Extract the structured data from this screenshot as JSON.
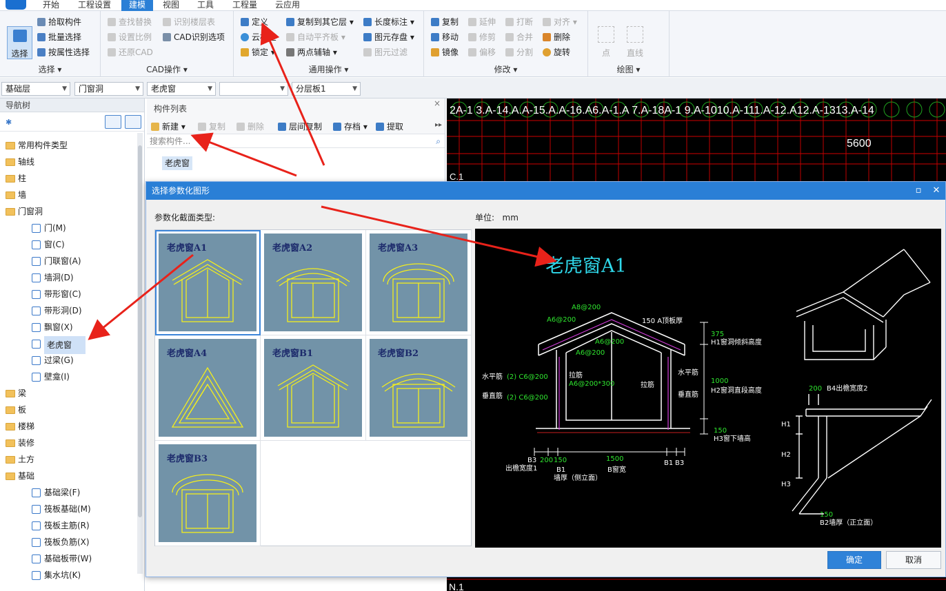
{
  "menu": {
    "items": [
      "开始",
      "工程设置",
      "建模",
      "视图",
      "工具",
      "工程量",
      "云应用"
    ],
    "active_index": 2
  },
  "ribbon": {
    "select_group": {
      "title": "选择",
      "select_label": "选择",
      "pick": "拾取构件",
      "batch": "批量选择",
      "by_attr": "按属性选择"
    },
    "cad_group": {
      "title": "CAD操作",
      "find_replace": "查找替换",
      "recognize_floor": "识别楼层表",
      "set_scale": "设置比例",
      "cad_options": "CAD识别选项",
      "restore_cad": "还原CAD"
    },
    "common_group": {
      "title": "通用操作",
      "define": "定义",
      "cloud_check": "云检查",
      "lock": "锁定",
      "copy_other_floor": "复制到其它层",
      "auto_align": "自动平齐板",
      "two_point_axis": "两点辅轴",
      "length_dim": "长度标注",
      "elem_save": "图元存盘",
      "elem_filter": "图元过滤"
    },
    "modify_group": {
      "title": "修改",
      "copy": "复制",
      "extend": "延伸",
      "break": "打断",
      "align": "对齐",
      "move": "移动",
      "trim": "修剪",
      "merge": "合并",
      "delete": "删除",
      "mirror": "镜像",
      "offset": "偏移",
      "split": "分割",
      "rotate": "旋转"
    },
    "draw_group": {
      "title": "绘图",
      "point": "点",
      "line": "直线"
    }
  },
  "combos": [
    "基础层",
    "门窗洞",
    "老虎窗",
    "",
    "分层板1"
  ],
  "nav": {
    "title": "导航树",
    "items": [
      {
        "label": "常用构件类型",
        "type": "folder"
      },
      {
        "label": "轴线",
        "type": "folder"
      },
      {
        "label": "柱",
        "type": "folder"
      },
      {
        "label": "墙",
        "type": "folder"
      },
      {
        "label": "门窗洞",
        "type": "folder-open"
      },
      {
        "label": "门(M)",
        "type": "leaf"
      },
      {
        "label": "窗(C)",
        "type": "leaf"
      },
      {
        "label": "门联窗(A)",
        "type": "leaf"
      },
      {
        "label": "墙洞(D)",
        "type": "leaf"
      },
      {
        "label": "带形窗(C)",
        "type": "leaf"
      },
      {
        "label": "带形洞(D)",
        "type": "leaf"
      },
      {
        "label": "飘窗(X)",
        "type": "leaf"
      },
      {
        "label": "老虎窗",
        "type": "leaf-selected"
      },
      {
        "label": "过梁(G)",
        "type": "leaf"
      },
      {
        "label": "壁龛(I)",
        "type": "leaf"
      },
      {
        "label": "梁",
        "type": "folder"
      },
      {
        "label": "板",
        "type": "folder"
      },
      {
        "label": "楼梯",
        "type": "folder"
      },
      {
        "label": "装修",
        "type": "folder"
      },
      {
        "label": "土方",
        "type": "folder"
      },
      {
        "label": "基础",
        "type": "folder-open"
      },
      {
        "label": "基础梁(F)",
        "type": "leaf"
      },
      {
        "label": "筏板基础(M)",
        "type": "leaf"
      },
      {
        "label": "筏板主筋(R)",
        "type": "leaf"
      },
      {
        "label": "筏板负筋(X)",
        "type": "leaf"
      },
      {
        "label": "基础板带(W)",
        "type": "leaf"
      },
      {
        "label": "集水坑(K)",
        "type": "leaf"
      }
    ]
  },
  "component_list": {
    "title": "构件列表",
    "tools": {
      "new": "新建",
      "copy": "复制",
      "delete": "删除",
      "floor_copy": "层间复制",
      "save": "存档",
      "extract": "提取"
    },
    "search_placeholder": "搜索构件...",
    "item": "老虎窗"
  },
  "cad_top_labels": "2A-1  3.A-14.A.A-15.A.A-16.A6.A-1.A  7.A-18A-1  9.A-1010.A-111.A-12.A12.A-1313.A-14",
  "cad_dim": "5600",
  "cad_left_label": "C.1",
  "cad_bottom_label": "N.1",
  "dialog": {
    "title": "选择参数化图形",
    "section_label": "参数化截面类型:",
    "unit_label": "单位:",
    "unit_value": "mm",
    "shapes": [
      {
        "name": "老虎窗A1",
        "roof": "gable"
      },
      {
        "name": "老虎窗A2",
        "roof": "arc"
      },
      {
        "name": "老虎窗A3",
        "roof": "round"
      },
      {
        "name": "老虎窗A4",
        "roof": "triangle"
      },
      {
        "name": "老虎窗B1",
        "roof": "gable"
      },
      {
        "name": "老虎窗B2",
        "roof": "arc"
      },
      {
        "name": "老虎窗B3",
        "roof": "round"
      }
    ],
    "selected_index": 0,
    "preview": {
      "title": "老虎窗A1",
      "labels": {
        "a_top": "A8@200",
        "a_left": "A6@200",
        "a_thick": "150 A顶板厚",
        "a_mid1": "A6@200",
        "a_mid2": "A6@200",
        "h1_val": "375",
        "h1_label": "H1窗洞倾斜高度",
        "h2_val": "1000",
        "h2_label": "H2窗洞直段高度",
        "h3_val": "150",
        "h3_label": "H3窗下墙高",
        "horiz_bar": "水平筋",
        "horiz_spec": "(2) C6@200",
        "vert_bar": "垂直筋",
        "vert_spec": "(2) C6@200",
        "tie_bar": "拉筋",
        "tie_spec": "A6@200*300",
        "tie_bar_r": "拉筋",
        "horiz_bar_r": "水平筋",
        "vert_bar_r": "垂直筋",
        "b3": "B3",
        "d200": "200",
        "d150": "150",
        "d1500": "1500",
        "overhang1": "出檐宽度1",
        "b1": "B1",
        "wall_side": "墙厚（侧立面）",
        "b_width": "B窗宽",
        "b1r": "B1",
        "b3r": "B3",
        "b4_val": "200",
        "b4_label": "B4出檐宽度2",
        "h1": "H1",
        "h2": "H2",
        "h3": "H3",
        "b2_val": "150",
        "b2_label": "B2墙厚（正立面）"
      }
    },
    "ok": "确定",
    "cancel": "取消"
  }
}
